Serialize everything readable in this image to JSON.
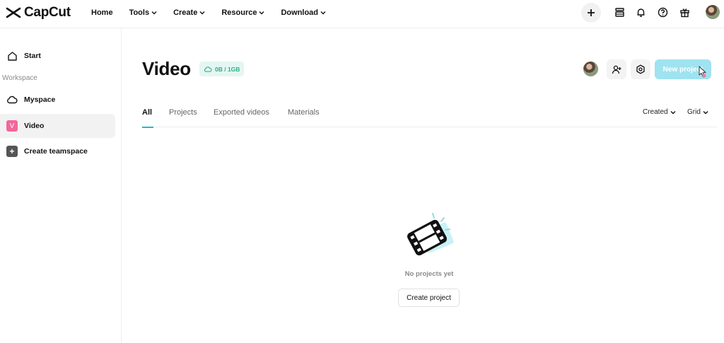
{
  "app": {
    "brand": "CapCut"
  },
  "nav": {
    "items": [
      {
        "label": "Home",
        "has_dropdown": false
      },
      {
        "label": "Tools",
        "has_dropdown": true
      },
      {
        "label": "Create",
        "has_dropdown": true
      },
      {
        "label": "Resource",
        "has_dropdown": true
      },
      {
        "label": "Download",
        "has_dropdown": true
      }
    ]
  },
  "topbar_icons": [
    "plus-icon",
    "layers-icon",
    "bell-icon",
    "help-icon",
    "gift-icon",
    "user-avatar"
  ],
  "sidebar": {
    "start_label": "Start",
    "section_label": "Workspace",
    "items": [
      {
        "label": "Myspace",
        "icon": "cloud-icon"
      },
      {
        "label": "Video",
        "icon": "V",
        "active": true
      },
      {
        "label": "Create teamspace",
        "icon": "plus-icon"
      }
    ]
  },
  "main": {
    "title": "Video",
    "storage": "0B / 1GB",
    "new_project_label": "New project",
    "tabs": [
      {
        "label": "All",
        "active": true
      },
      {
        "label": "Projects"
      },
      {
        "label": "Exported videos"
      },
      {
        "label": "Materials"
      }
    ],
    "sort_label": "Created",
    "view_label": "Grid",
    "empty_text": "No projects yet",
    "create_label": "Create project"
  },
  "colors": {
    "accent": "#21b9c9",
    "new_project_bg": "#9fe3f0",
    "storage_bg": "#e4f6f1",
    "storage_text": "#2fae8e",
    "video_badge": "#f2679a"
  }
}
